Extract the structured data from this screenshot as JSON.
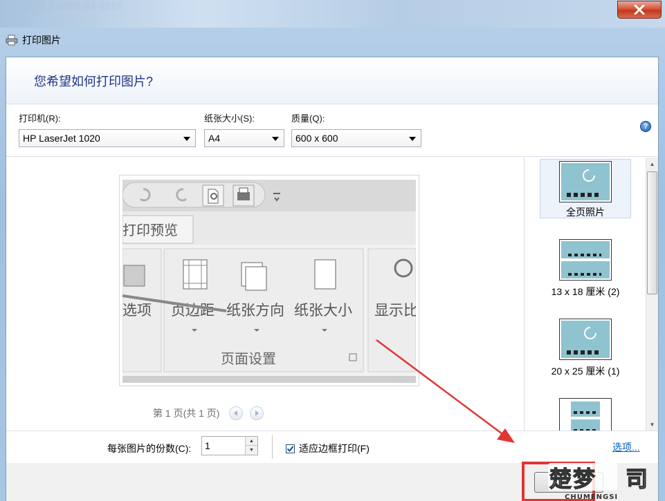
{
  "window": {
    "title": "打印图片"
  },
  "header": {
    "question": "您希望如何打印图片?"
  },
  "settings": {
    "printer_label": "打印机(R):",
    "printer_value": "HP LaserJet 1020",
    "paper_label": "纸张大小(S):",
    "paper_value": "A4",
    "quality_label": "质量(Q):",
    "quality_value": "600 x 600"
  },
  "preview": {
    "tab_label": "打印预览",
    "ribbon_items": [
      "选项",
      "页边距",
      "纸张方向",
      "纸张大小",
      "显示比"
    ],
    "group_label": "页面设置",
    "page_status": "第 1 页(共 1 页)"
  },
  "layouts": [
    {
      "label": "全页照片",
      "selected": true
    },
    {
      "label": "13 x 18 厘米 (2)",
      "selected": false
    },
    {
      "label": "20 x 25 厘米 (1)",
      "selected": false
    },
    {
      "label": "",
      "selected": false
    }
  ],
  "options": {
    "copies_label": "每张图片的份数(C):",
    "copies_value": "1",
    "fit_label": "适应边框打印(F)",
    "fit_checked": true,
    "options_link": "选项..."
  },
  "watermark": {
    "brand": "CHUMENGSI"
  },
  "colors": {
    "header_text": "#1e3287",
    "link": "#0060c0",
    "highlight_border": "#e23434"
  }
}
